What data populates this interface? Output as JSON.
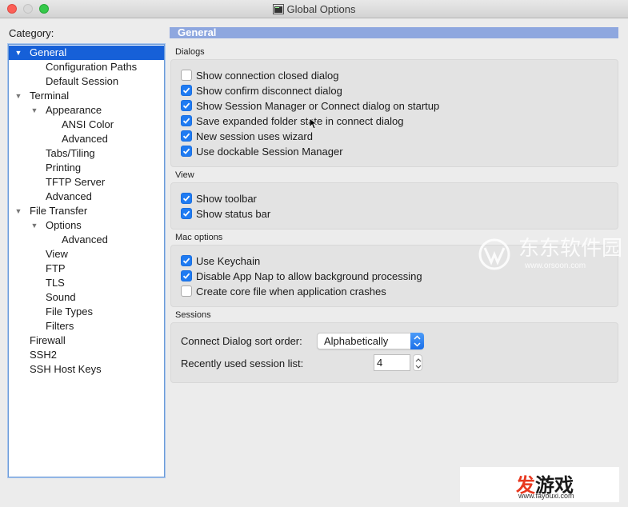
{
  "window": {
    "title": "Global Options"
  },
  "category_label": "Category:",
  "tree": [
    {
      "label": "General",
      "level": 0,
      "expanded": true,
      "selected": true
    },
    {
      "label": "Configuration Paths",
      "level": 1
    },
    {
      "label": "Default Session",
      "level": 1
    },
    {
      "label": "Terminal",
      "level": 0,
      "expanded": true
    },
    {
      "label": "Appearance",
      "level": 1,
      "expanded": true
    },
    {
      "label": "ANSI Color",
      "level": 2
    },
    {
      "label": "Advanced",
      "level": 2
    },
    {
      "label": "Tabs/Tiling",
      "level": 1
    },
    {
      "label": "Printing",
      "level": 1
    },
    {
      "label": "TFTP Server",
      "level": 1
    },
    {
      "label": "Advanced",
      "level": 1
    },
    {
      "label": "File Transfer",
      "level": 0,
      "expanded": true
    },
    {
      "label": "Options",
      "level": 1,
      "expanded": true
    },
    {
      "label": "Advanced",
      "level": 2
    },
    {
      "label": "View",
      "level": 1
    },
    {
      "label": "FTP",
      "level": 1
    },
    {
      "label": "TLS",
      "level": 1
    },
    {
      "label": "Sound",
      "level": 1
    },
    {
      "label": "File Types",
      "level": 1
    },
    {
      "label": "Filters",
      "level": 1
    },
    {
      "label": "Firewall",
      "level": 0
    },
    {
      "label": "SSH2",
      "level": 0
    },
    {
      "label": "SSH Host Keys",
      "level": 0
    }
  ],
  "panel": {
    "header": "General",
    "dialogs": {
      "title": "Dialogs",
      "items": [
        {
          "label": "Show connection closed dialog",
          "checked": false
        },
        {
          "label": "Show confirm disconnect dialog",
          "checked": true
        },
        {
          "label": "Show Session Manager or Connect dialog on startup",
          "checked": true
        },
        {
          "label": "Save expanded folder state in connect dialog",
          "checked": true
        },
        {
          "label": "New session uses wizard",
          "checked": true
        },
        {
          "label": "Use dockable Session Manager",
          "checked": true
        }
      ]
    },
    "view": {
      "title": "View",
      "items": [
        {
          "label": "Show toolbar",
          "checked": true
        },
        {
          "label": "Show status bar",
          "checked": true
        }
      ]
    },
    "mac": {
      "title": "Mac options",
      "items": [
        {
          "label": "Use Keychain",
          "checked": true
        },
        {
          "label": "Disable App Nap to allow background processing",
          "checked": true
        },
        {
          "label": "Create core file when application crashes",
          "checked": false
        }
      ]
    },
    "sessions": {
      "title": "Sessions",
      "sort_label": "Connect Dialog sort order:",
      "sort_value": "Alphabetically",
      "recent_label": "Recently used session list:",
      "recent_value": "4"
    }
  },
  "watermarks": {
    "orsoon_text": "东东软件园",
    "orsoon_url": "www.orsoon.com",
    "fayouxi_text_red": "发",
    "fayouxi_text": "游戏",
    "fayouxi_url": "www.fayouxi.com"
  }
}
